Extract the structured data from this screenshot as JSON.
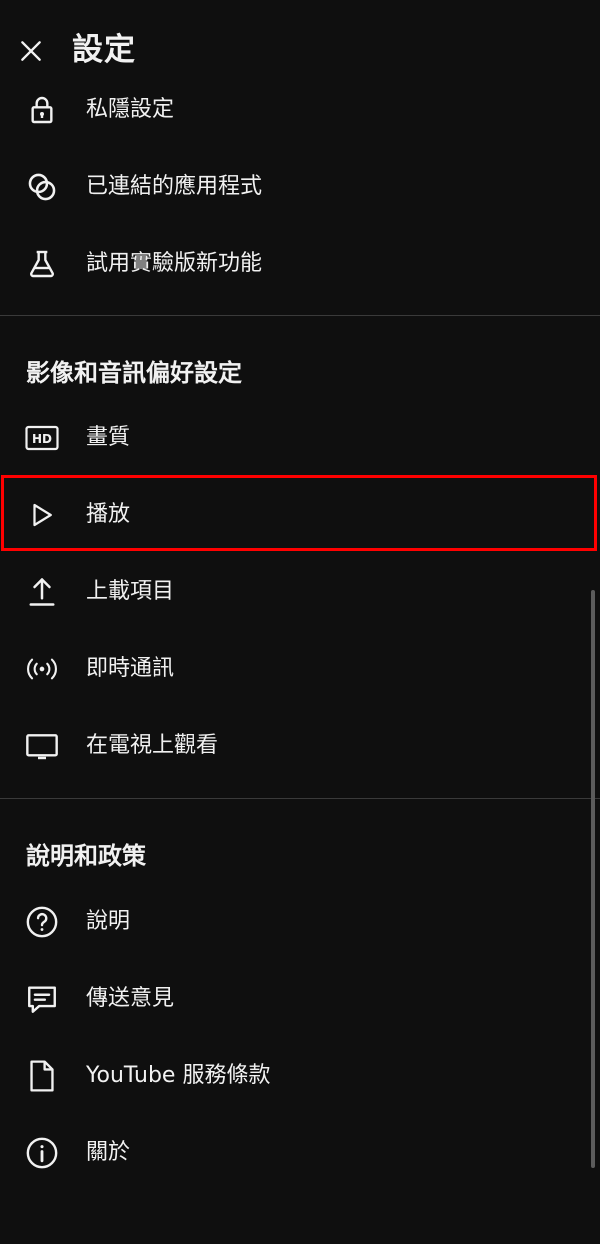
{
  "header": {
    "title": "設定"
  },
  "accounts_items": [
    {
      "label": "私隱設定",
      "icon": "lock-icon"
    },
    {
      "label": "已連結的應用程式",
      "icon": "linked-apps-icon"
    },
    {
      "label": "試用實驗版新功能",
      "icon": "flask-icon"
    }
  ],
  "video_section": {
    "title": "影像和音訊偏好設定",
    "items": [
      {
        "label": "畫質",
        "icon": "hd-icon",
        "badge": "HD"
      },
      {
        "label": "播放",
        "icon": "play-icon",
        "selected": true
      },
      {
        "label": "上載項目",
        "icon": "upload-icon"
      },
      {
        "label": "即時通訊",
        "icon": "live-broadcast-icon"
      },
      {
        "label": "在電視上觀看",
        "icon": "tv-icon"
      }
    ]
  },
  "help_section": {
    "title": "說明和政策",
    "items": [
      {
        "label": "說明",
        "icon": "help-circle-icon"
      },
      {
        "label": "傳送意見",
        "icon": "feedback-icon"
      },
      {
        "label": "YouTube 服務條款",
        "icon": "document-icon"
      },
      {
        "label": "關於",
        "icon": "info-icon"
      }
    ]
  },
  "colors": {
    "background": "#0f0f0f",
    "text": "#f1f1f1",
    "highlight": "#ff0000",
    "divider": "#3a3a3a"
  }
}
